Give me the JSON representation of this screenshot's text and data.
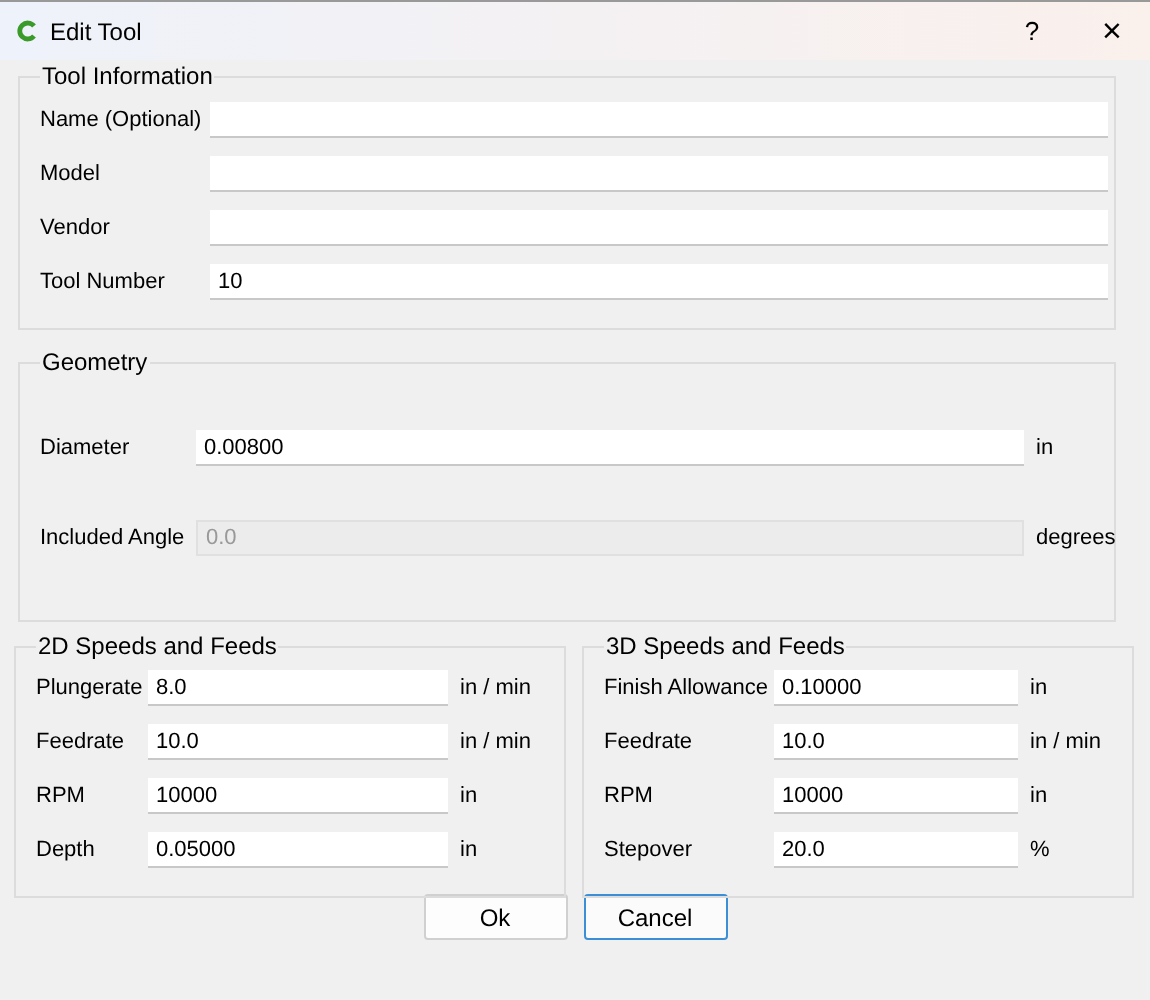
{
  "window": {
    "title": "Edit Tool",
    "help": "?",
    "close": "×"
  },
  "tool_information": {
    "title": "Tool Information",
    "fields": [
      {
        "label": "Name (Optional)",
        "disabled": false
      },
      {
        "label": "Model",
        "disabled": false
      },
      {
        "label": "Vendor",
        "disabled": false
      },
      {
        "label": "Tool Number",
        "value": "10",
        "disabled": false
      }
    ]
  },
  "geometry": {
    "title": "Geometry",
    "fields": [
      {
        "label": "Diameter",
        "value": "0.00800",
        "unit": "in",
        "disabled": false
      },
      {
        "label": "Included Angle",
        "value": "0.0",
        "unit": "degrees",
        "disabled": true
      }
    ]
  },
  "speeds_2d": {
    "title": "2D Speeds and Feeds",
    "fields": [
      {
        "label": "Plungerate",
        "value": "8.0",
        "unit": "in / min",
        "disabled": false
      },
      {
        "label": "Feedrate",
        "value": "10.0",
        "unit": "in / min",
        "disabled": false
      },
      {
        "label": "RPM",
        "value": "10000",
        "unit": "in",
        "disabled": false
      },
      {
        "label": "Depth",
        "value": "0.05000",
        "unit": "in",
        "disabled": false
      }
    ]
  },
  "speeds_3d": {
    "title": "3D Speeds and Feeds",
    "fields": [
      {
        "label": "Finish Allowance",
        "value": "0.10000",
        "unit": "in",
        "disabled": false
      },
      {
        "label": "Feedrate",
        "value": "10.0",
        "unit": "in / min",
        "disabled": false
      },
      {
        "label": "RPM",
        "value": "10000",
        "unit": "in",
        "disabled": false
      },
      {
        "label": "Stepover",
        "value": "20.0",
        "unit": "%",
        "disabled": false
      }
    ]
  },
  "buttons": [
    {
      "label": "Ok",
      "selected": false
    },
    {
      "label": "Cancel",
      "selected": true
    }
  ]
}
